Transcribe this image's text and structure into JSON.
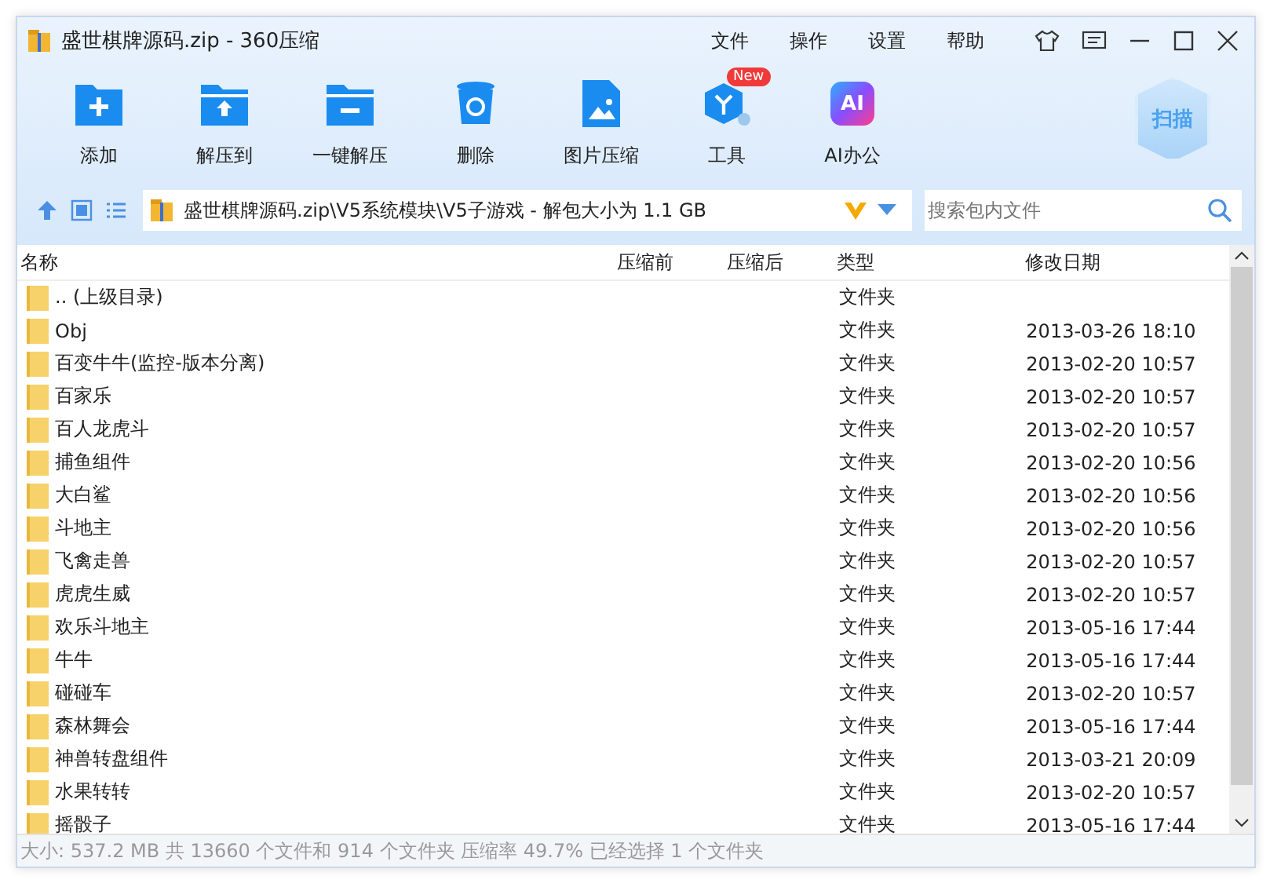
{
  "window": {
    "title": "盛世棋牌源码.zip - 360压缩"
  },
  "menu": [
    "文件",
    "操作",
    "设置",
    "帮助"
  ],
  "toolbar": [
    {
      "kind": "add",
      "label": "添加"
    },
    {
      "kind": "extract",
      "label": "解压到"
    },
    {
      "kind": "oneclick",
      "label": "一键解压"
    },
    {
      "kind": "delete",
      "label": "删除"
    },
    {
      "kind": "image",
      "label": "图片压缩"
    },
    {
      "kind": "tools",
      "label": "工具",
      "badge": "New"
    },
    {
      "kind": "ai",
      "label": "AI办公",
      "icon_text": "AI"
    }
  ],
  "scan_button": "扫描",
  "address": {
    "path": "盛世棋牌源码.zip\\V5系统模块\\V5子游戏 - 解包大小为 1.1 GB"
  },
  "search": {
    "placeholder": "搜索包内文件"
  },
  "table": {
    "columns": [
      "名称",
      "压缩前",
      "压缩后",
      "类型",
      "修改日期"
    ],
    "rows": [
      {
        "name": ".. (上级目录)",
        "type": "文件夹",
        "modified": ""
      },
      {
        "name": "Obj",
        "type": "文件夹",
        "modified": "2013-03-26 18:10"
      },
      {
        "name": "百变牛牛(监控-版本分离)",
        "type": "文件夹",
        "modified": "2013-02-20 10:57"
      },
      {
        "name": "百家乐",
        "type": "文件夹",
        "modified": "2013-02-20 10:57"
      },
      {
        "name": "百人龙虎斗",
        "type": "文件夹",
        "modified": "2013-02-20 10:57"
      },
      {
        "name": "捕鱼组件",
        "type": "文件夹",
        "modified": "2013-02-20 10:56"
      },
      {
        "name": "大白鲨",
        "type": "文件夹",
        "modified": "2013-02-20 10:56"
      },
      {
        "name": "斗地主",
        "type": "文件夹",
        "modified": "2013-02-20 10:56"
      },
      {
        "name": "飞禽走兽",
        "type": "文件夹",
        "modified": "2013-02-20 10:57"
      },
      {
        "name": "虎虎生威",
        "type": "文件夹",
        "modified": "2013-02-20 10:57"
      },
      {
        "name": "欢乐斗地主",
        "type": "文件夹",
        "modified": "2013-05-16 17:44"
      },
      {
        "name": "牛牛",
        "type": "文件夹",
        "modified": "2013-05-16 17:44"
      },
      {
        "name": "碰碰车",
        "type": "文件夹",
        "modified": "2013-02-20 10:57"
      },
      {
        "name": "森林舞会",
        "type": "文件夹",
        "modified": "2013-05-16 17:44"
      },
      {
        "name": "神兽转盘组件",
        "type": "文件夹",
        "modified": "2013-03-21 20:09"
      },
      {
        "name": "水果转转",
        "type": "文件夹",
        "modified": "2013-02-20 10:57"
      },
      {
        "name": "摇骰子",
        "type": "文件夹",
        "modified": "2013-05-16 17:44"
      }
    ]
  },
  "status_bar": "大小: 537.2 MB 共 13660 个文件和 914 个文件夹 压缩率 49.7% 已经选择 1 个文件夹"
}
